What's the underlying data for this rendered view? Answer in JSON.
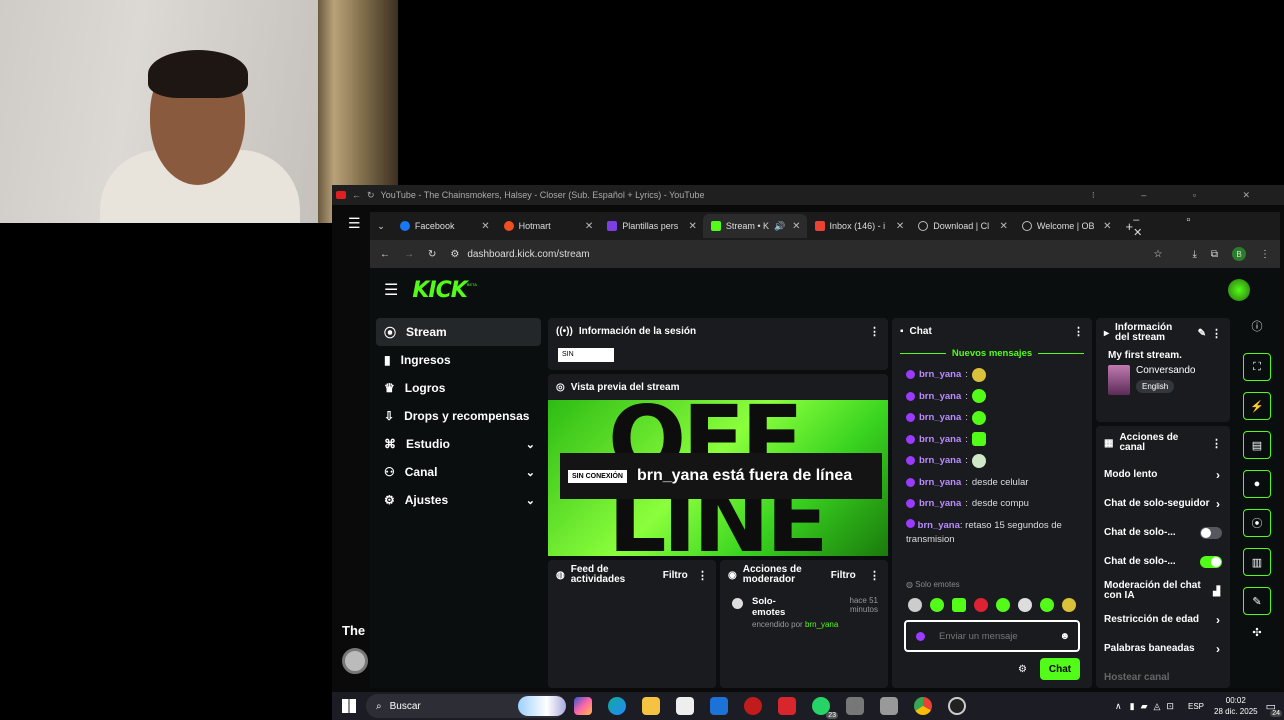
{
  "youtube": {
    "title": "YouTube - The Chainsmokers, Halsey - Closer (Sub. Español + Lyrics) - YouTube",
    "overlay_text": "The"
  },
  "tabs": [
    {
      "label": "Facebook",
      "color": "#1877f2"
    },
    {
      "label": "Hotmart",
      "color": "#f04e23"
    },
    {
      "label": "Plantillas pers",
      "color": "#7b3fe4"
    },
    {
      "label": "Stream • K",
      "color": "#53fc18"
    },
    {
      "label": "Inbox (146) - i",
      "color": "#ea4335"
    },
    {
      "label": "Download | Cl",
      "color": "#bbbbbb"
    },
    {
      "label": "Welcome | OB",
      "color": "#bbbbbb"
    }
  ],
  "address": {
    "url": "dashboard.kick.com/stream"
  },
  "kick": {
    "logo": "KICK",
    "logo_badge": "BETA",
    "nav": [
      {
        "label": "Stream",
        "icon": "broadcast-icon"
      },
      {
        "label": "Ingresos",
        "icon": "money-icon"
      },
      {
        "label": "Logros",
        "icon": "trophy-icon"
      },
      {
        "label": "Drops y recompensas",
        "icon": "gift-icon"
      },
      {
        "label": "Estudio",
        "icon": "studio-icon"
      },
      {
        "label": "Canal",
        "icon": "users-icon"
      },
      {
        "label": "Ajustes",
        "icon": "gear-icon"
      }
    ],
    "session": {
      "title": "Información de la sesión",
      "status": "SIN"
    },
    "preview": {
      "title": "Vista previa del stream",
      "badge": "SIN CONEXIÓN",
      "offline_text": "brn_yana está fuera de línea",
      "bg_text": "OFFLINE"
    },
    "feed": {
      "title": "Feed de actividades",
      "filter": "Filtro"
    },
    "mod": {
      "title": "Acciones de moderador",
      "filter": "Filtro",
      "item_title": "Solo-emotes",
      "item_time": "hace 51 minutos",
      "item_by": "encendido por",
      "item_user": "brn_yana"
    },
    "chat": {
      "title": "Chat",
      "new_messages": "Nuevos mensajes",
      "messages": [
        {
          "user": "brn_yana",
          "text": ""
        },
        {
          "user": "brn_yana",
          "text": ""
        },
        {
          "user": "brn_yana",
          "text": ""
        },
        {
          "user": "brn_yana",
          "text": ""
        },
        {
          "user": "brn_yana",
          "text": ""
        },
        {
          "user": "brn_yana",
          "text": "desde celular"
        },
        {
          "user": "brn_yana",
          "text": "desde compu"
        },
        {
          "user": "brn_yana",
          "text": "retaso 15 segundos de transmision"
        }
      ],
      "emotes_only": "Solo emotes",
      "placeholder": "Enviar un mensaje",
      "send": "Chat"
    },
    "stream_info": {
      "title": "Información del stream",
      "stream_title": "My first stream.",
      "category": "Conversando",
      "language": "English"
    },
    "channel_actions": {
      "title": "Acciones de canal",
      "items": [
        {
          "label": "Modo lento",
          "kind": "arrow"
        },
        {
          "label": "Chat de solo-seguidor",
          "kind": "arrow"
        },
        {
          "label": "Chat de solo-...",
          "kind": "toggle-off"
        },
        {
          "label": "Chat de solo-...",
          "kind": "toggle-on"
        },
        {
          "label": "Moderación del chat con IA",
          "kind": "chart"
        },
        {
          "label": "Restricción de edad",
          "kind": "arrow"
        },
        {
          "label": "Palabras baneadas",
          "kind": "arrow"
        },
        {
          "label": "Hostear canal",
          "kind": "none"
        }
      ]
    }
  },
  "taskbar": {
    "search": "Buscar",
    "lang": "ESP",
    "time": "00:02",
    "date": "28 dic. 2025",
    "badge": "24",
    "chat_badge": "23"
  },
  "colors": {
    "accent": "#53fc18",
    "user": "#b98cff",
    "panel": "#191b1f"
  }
}
